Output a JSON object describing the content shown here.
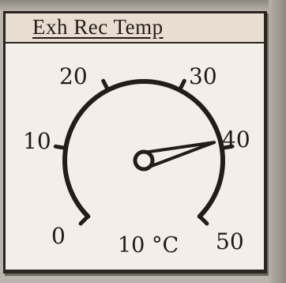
{
  "gauge": {
    "title": "Exh Rec Temp",
    "scale_labels": [
      "0",
      "10",
      "20",
      "30",
      "40",
      "50"
    ],
    "reading": "10",
    "unit": "°C",
    "needle_value": 39
  },
  "colors": {
    "panel_bg": "#f3eeea",
    "title_bg": "#e8ddd0",
    "ink": "#231d18"
  }
}
